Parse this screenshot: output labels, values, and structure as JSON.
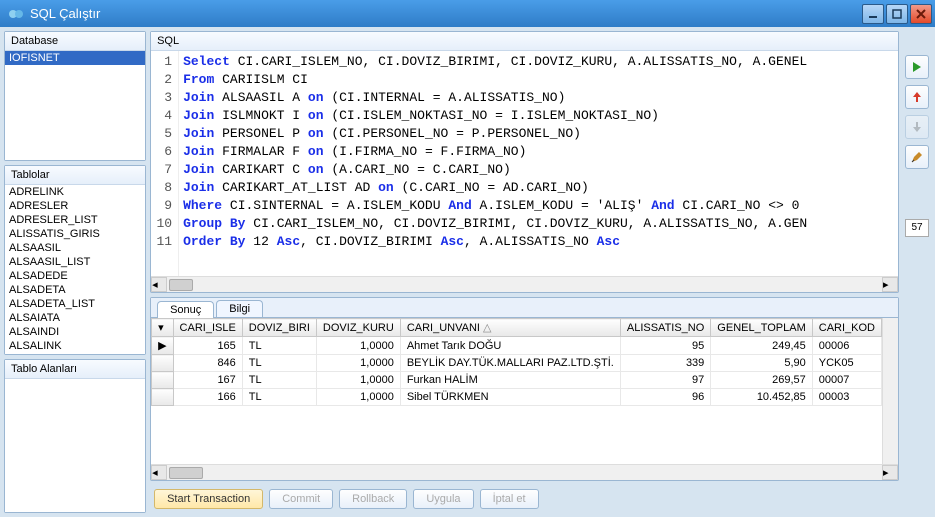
{
  "window": {
    "title": "SQL Çalıştır"
  },
  "left": {
    "database_label": "Database",
    "databases": [
      "IOFISNET"
    ],
    "selected_db": 0,
    "tables_label": "Tablolar",
    "tables": [
      "ADRELINK",
      "ADRESLER",
      "ADRESLER_LIST",
      "ALISSATIS_GIRIS",
      "ALSAASIL",
      "ALSAASIL_LIST",
      "ALSADEDE",
      "ALSADETA",
      "ALSADETA_LIST",
      "ALSAIATA",
      "ALSAINDI",
      "ALSALINK"
    ],
    "fields_label": "Tablo Alanları"
  },
  "sql": {
    "label": "SQL",
    "lines": [
      {
        "n": 1,
        "t": [
          [
            "kw",
            "Select"
          ],
          [
            "",
            " CI.CARI_ISLEM_NO, CI.DOVIZ_BIRIMI, CI.DOVIZ_KURU, A.ALISSATIS_NO, A.GENEL"
          ]
        ]
      },
      {
        "n": 2,
        "t": [
          [
            "kw",
            "From"
          ],
          [
            "",
            " CARIISLM CI"
          ]
        ]
      },
      {
        "n": 3,
        "t": [
          [
            "kw",
            "Join"
          ],
          [
            "",
            " ALSAASIL A "
          ],
          [
            "kw",
            "on"
          ],
          [
            "",
            " (CI.INTERNAL = A.ALISSATIS_NO)"
          ]
        ]
      },
      {
        "n": 4,
        "t": [
          [
            "kw",
            "Join"
          ],
          [
            "",
            " ISLMNOKT I "
          ],
          [
            "kw",
            "on"
          ],
          [
            "",
            " (CI.ISLEM_NOKTASI_NO = I.ISLEM_NOKTASI_NO)"
          ]
        ]
      },
      {
        "n": 5,
        "t": [
          [
            "kw",
            "Join"
          ],
          [
            "",
            " PERSONEL P "
          ],
          [
            "kw",
            "on"
          ],
          [
            "",
            " (CI.PERSONEL_NO = P.PERSONEL_NO)"
          ]
        ]
      },
      {
        "n": 6,
        "t": [
          [
            "kw",
            "Join"
          ],
          [
            "",
            " FIRMALAR F "
          ],
          [
            "kw",
            "on"
          ],
          [
            "",
            " (I.FIRMA_NO = F.FIRMA_NO)"
          ]
        ]
      },
      {
        "n": 7,
        "t": [
          [
            "kw",
            "Join"
          ],
          [
            "",
            " CARIKART C "
          ],
          [
            "kw",
            "on"
          ],
          [
            "",
            " (A.CARI_NO = C.CARI_NO)"
          ]
        ]
      },
      {
        "n": 8,
        "t": [
          [
            "kw",
            "Join"
          ],
          [
            "",
            " CARIKART_AT_LIST AD "
          ],
          [
            "kw",
            "on"
          ],
          [
            "",
            " (C.CARI_NO = AD.CARI_NO)"
          ]
        ]
      },
      {
        "n": 9,
        "t": [
          [
            "kw",
            "Where"
          ],
          [
            "",
            " CI.SINTERNAL = A.ISLEM_KODU "
          ],
          [
            "kw",
            "And"
          ],
          [
            "",
            " A.ISLEM_KODU = 'ALIŞ' "
          ],
          [
            "kw",
            "And"
          ],
          [
            "",
            " CI.CARI_NO <> 0"
          ]
        ]
      },
      {
        "n": 10,
        "t": [
          [
            "kw",
            "Group By"
          ],
          [
            "",
            " CI.CARI_ISLEM_NO, CI.DOVIZ_BIRIMI, CI.DOVIZ_KURU, A.ALISSATIS_NO, A.GEN"
          ]
        ]
      },
      {
        "n": 11,
        "t": [
          [
            "kw",
            "Order By"
          ],
          [
            "",
            " 12 "
          ],
          [
            "kw",
            "Asc"
          ],
          [
            "",
            ", CI.DOVIZ_BIRIMI "
          ],
          [
            "kw",
            "Asc"
          ],
          [
            "",
            ", A.ALISSATIS_NO "
          ],
          [
            "kw",
            "Asc"
          ]
        ]
      }
    ]
  },
  "result": {
    "tab_result": "Sonuç",
    "tab_info": "Bilgi",
    "columns": [
      "CARI_ISLE",
      "DOVIZ_BIRI",
      "DOVIZ_KURU",
      "CARI_UNVANI",
      "ALISSATIS_NO",
      "GENEL_TOPLAM",
      "CARI_KOD"
    ],
    "sort_col": 3,
    "rows": [
      {
        "ind": "▶",
        "c0": "165",
        "c1": "TL",
        "c2": "1,0000",
        "c3": "Ahmet Tarık DOĞU",
        "c4": "95",
        "c5": "249,45",
        "c6": "00006"
      },
      {
        "ind": "",
        "c0": "846",
        "c1": "TL",
        "c2": "1,0000",
        "c3": "BEYLİK DAY.TÜK.MALLARI PAZ.LTD.ŞTİ.",
        "c4": "339",
        "c5": "5,90",
        "c6": "YCK05"
      },
      {
        "ind": "",
        "c0": "167",
        "c1": "TL",
        "c2": "1,0000",
        "c3": "Furkan HALİM",
        "c4": "97",
        "c5": "269,57",
        "c6": "00007"
      },
      {
        "ind": "",
        "c0": "166",
        "c1": "TL",
        "c2": "1,0000",
        "c3": "Sibel TÜRKMEN",
        "c4": "96",
        "c5": "10.452,85",
        "c6": "00003"
      }
    ]
  },
  "buttons": {
    "start": "Start Transaction",
    "commit": "Commit",
    "rollback": "Rollback",
    "apply": "Uygula",
    "cancel": "İptal et"
  },
  "side": {
    "line_display": "57"
  }
}
